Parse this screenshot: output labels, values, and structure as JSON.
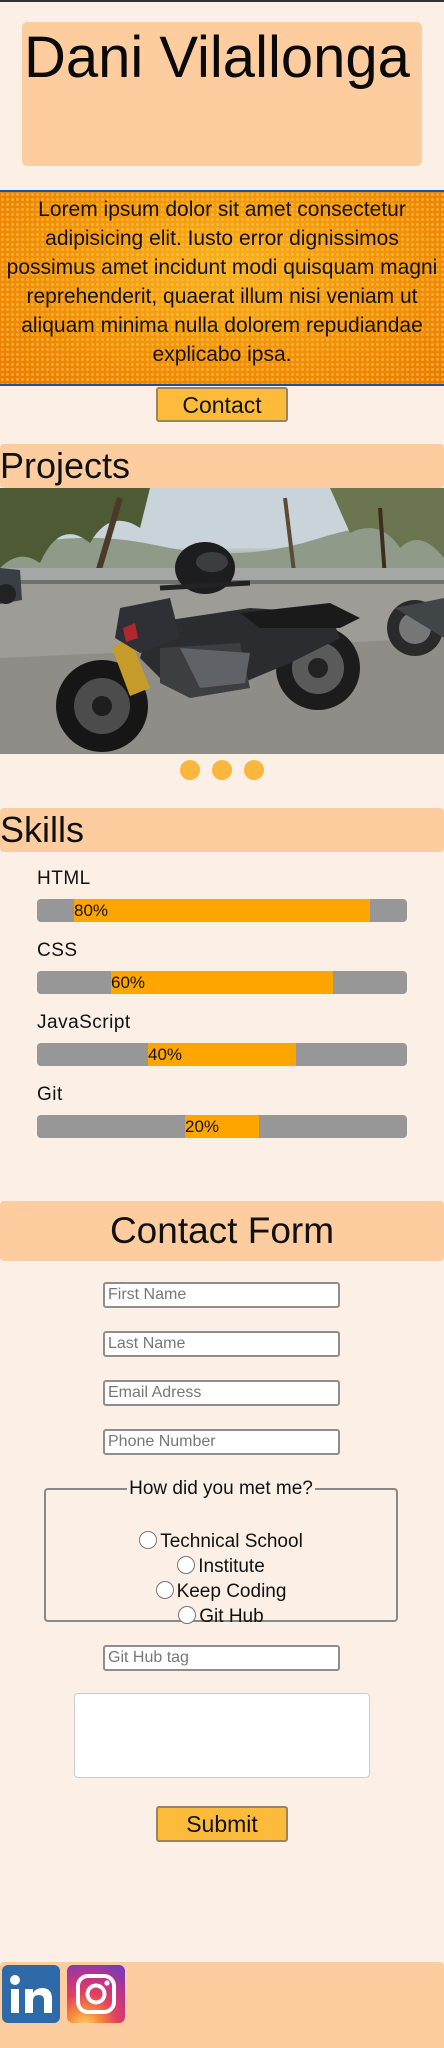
{
  "header": {
    "name": "Dani Vilallonga"
  },
  "hero": {
    "text": "Lorem ipsum dolor sit amet consectetur adipisicing elit. Iusto error dignissimos possimus amet incidunt modi quisquam magni reprehenderit, quaerat illum nisi veniam ut aliquam minima nulla dolorem repudiandae explicabo ipsa."
  },
  "contact_button": "Contact",
  "projects": {
    "title": "Projects",
    "image_icon": "motorcycle-photo",
    "carousel_dots": 3
  },
  "skills": {
    "title": "Skills",
    "items": [
      {
        "label": "HTML",
        "percent_label": "80%",
        "level": 0.8
      },
      {
        "label": "CSS",
        "percent_label": "60%",
        "level": 0.6
      },
      {
        "label": "JavaScript",
        "percent_label": "40%",
        "level": 0.4
      },
      {
        "label": "Git",
        "percent_label": "20%",
        "level": 0.2
      }
    ]
  },
  "contact_form": {
    "title": "Contact Form",
    "first_name": {
      "placeholder": "First Name",
      "value": ""
    },
    "last_name": {
      "placeholder": "Last Name",
      "value": ""
    },
    "email": {
      "placeholder": "Email Adress",
      "value": ""
    },
    "phone": {
      "placeholder": "Phone Number",
      "value": ""
    },
    "how_met": {
      "legend": "How did you met me?",
      "options": [
        "Technical School",
        "Institute",
        "Keep Coding",
        "Git Hub"
      ]
    },
    "github_tag": {
      "placeholder": "Git Hub tag",
      "value": ""
    },
    "message": {
      "value": ""
    },
    "submit_label": "Submit"
  },
  "footer": {
    "linkedin_icon": "linkedin-icon",
    "instagram_icon": "instagram-icon"
  },
  "colors": {
    "background": "#fbefe6",
    "band": "#fecd9f",
    "accent": "#ffa500",
    "button": "#fdbb3c",
    "bar_track": "#979797"
  }
}
